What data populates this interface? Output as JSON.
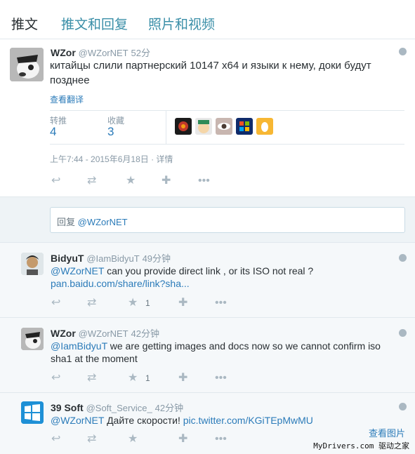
{
  "tabs": [
    "推文",
    "推文和回复",
    "照片和视频"
  ],
  "main_tweet": {
    "name": "WZor",
    "handle": "@WZorNET",
    "time": "52分",
    "text": "китайцы слили партнерский 10147 x64 и языки к нему, доки будут позднее",
    "translate": "查看翻译",
    "retweets_label": "转推",
    "retweets": "4",
    "likes_label": "收藏",
    "likes": "3",
    "timestamp": "上午7:44 - 2015年6月18日",
    "details": "· 详情"
  },
  "reply": {
    "prefix": "回复",
    "handle": "@WZorNET"
  },
  "replies": [
    {
      "name": "BidyuT",
      "handle": "@IamBidyuT",
      "time": "49分钟",
      "mention": "@WZorNET",
      "text": " can you provide direct link , or its ISO not real ?",
      "link": "pan.baidu.com/share/link?sha...",
      "fav_count": "1"
    },
    {
      "name": "WZor",
      "handle": "@WZorNET",
      "time": "42分钟",
      "mention": "@IamBidyuT",
      "text": "  we are getting images and docs now so we cannot confirm iso sha1 at the moment",
      "fav_count": "1"
    },
    {
      "name": "39 Soft",
      "handle": "@Soft_Service_",
      "time": "42分钟",
      "mention": "@WZorNET",
      "text": " Дайте скорости! ",
      "link": "pic.twitter.com/KGiTEpMwMU"
    }
  ],
  "footer": {
    "view_photo": "查看图片",
    "watermark": "MyDrivers.com 驱动之家"
  },
  "colors": {
    "accent": "#2b7bb9",
    "muted": "#8899a6",
    "icon": "#aab8c2"
  }
}
